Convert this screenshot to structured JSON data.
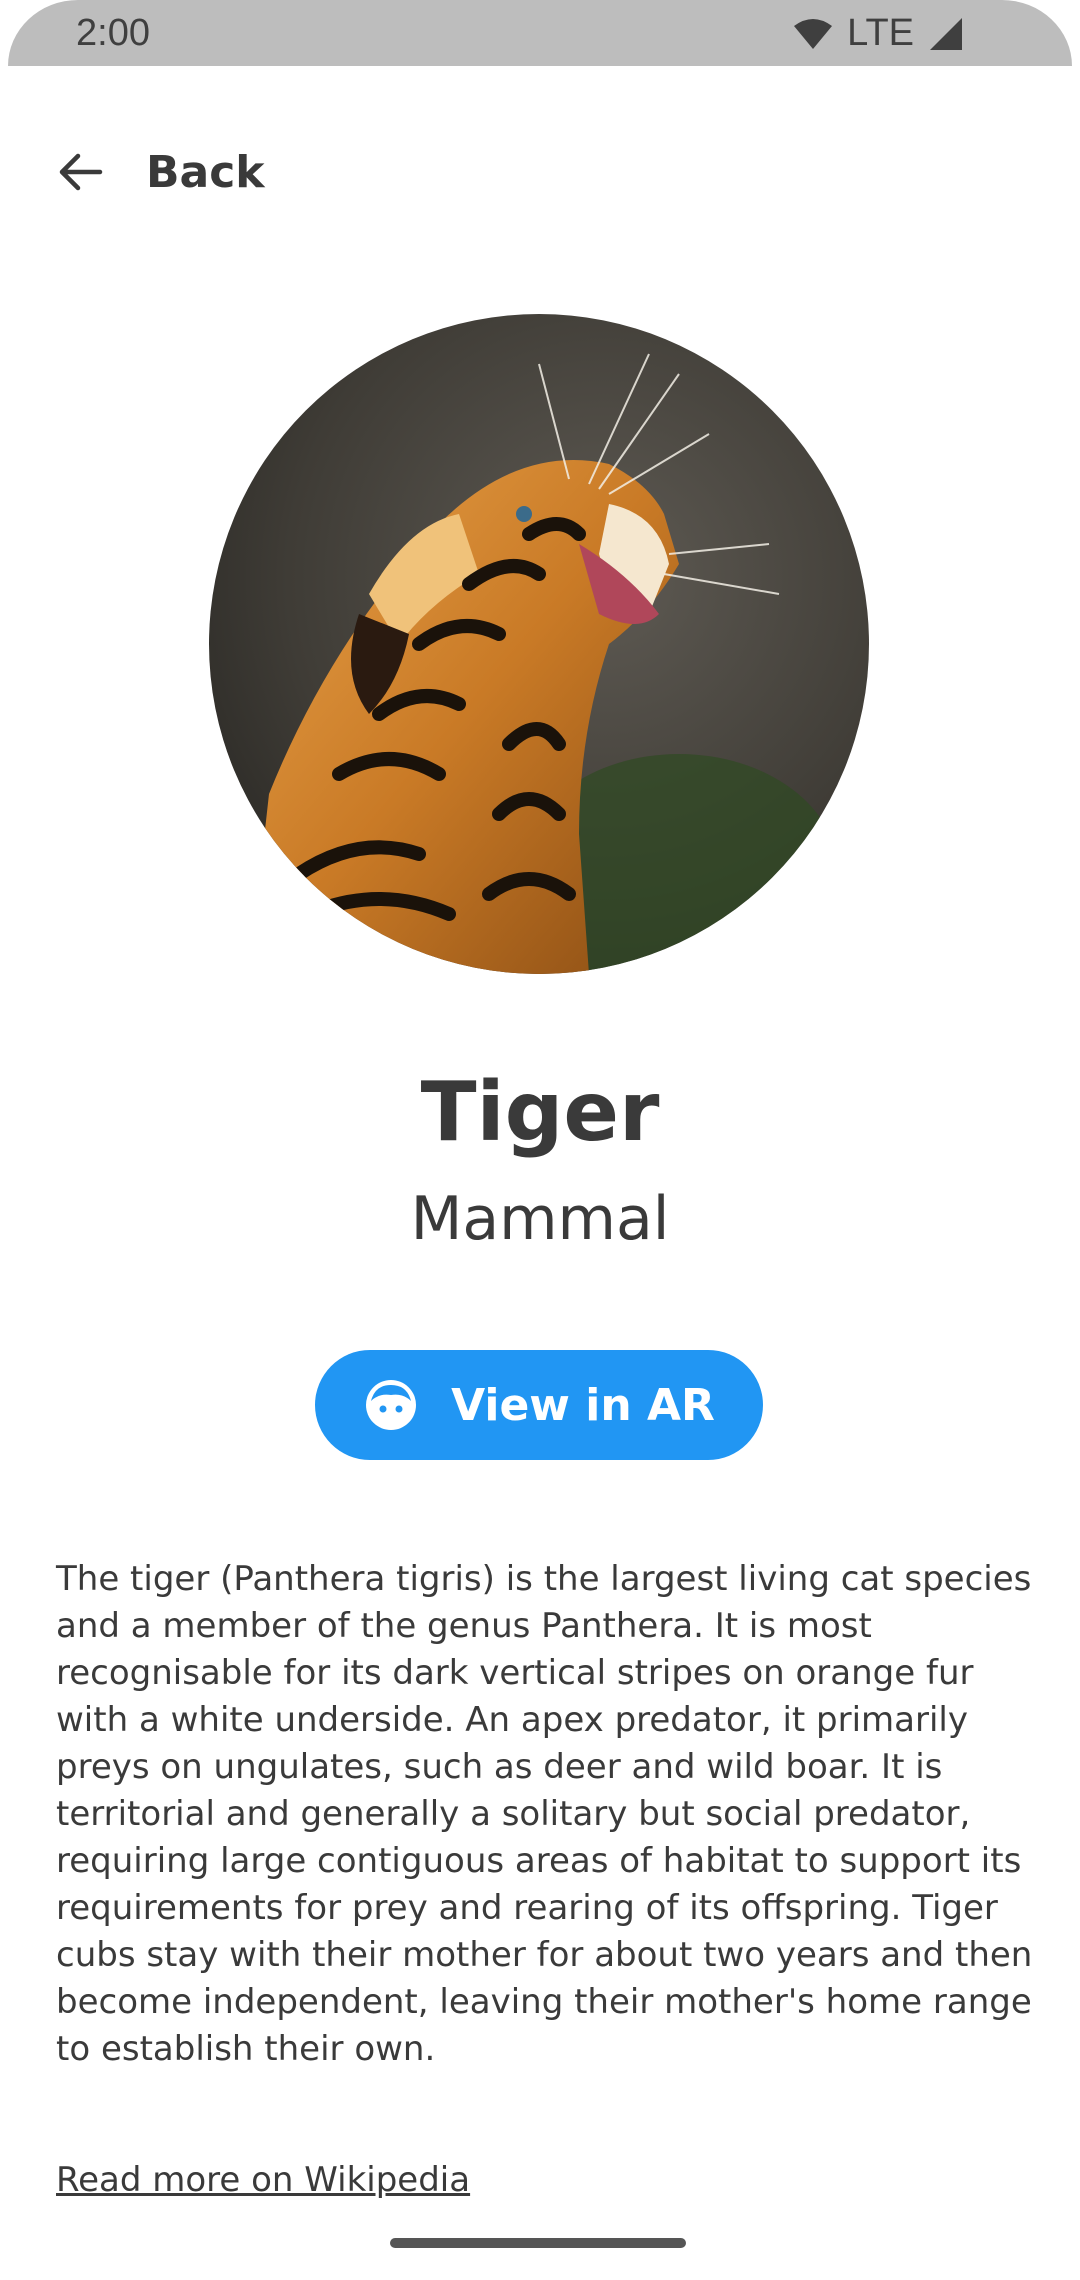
{
  "status_bar": {
    "time": "2:00",
    "network": "LTE"
  },
  "header": {
    "back_label": "Back"
  },
  "animal": {
    "name": "Tiger",
    "category": "Mammal",
    "image_icon": "tiger-photo"
  },
  "actions": {
    "ar_label": "View in AR",
    "ar_icon": "face-icon"
  },
  "description": "The tiger (Panthera tigris) is the largest living cat species and a member of the genus Panthera. It is most recognisable for its dark vertical stripes on orange fur with a white underside. An apex predator, it primarily preys on ungulates, such as deer and wild boar. It is territorial and generally a solitary but social predator, requiring large contiguous areas of habitat to support its requirements for prey and rearing of its offspring. Tiger cubs stay with their mother for about two years and then become independent, leaving their mother's home range to establish their own.",
  "link": {
    "label": "Read more on Wikipedia"
  },
  "colors": {
    "accent": "#2196f3",
    "text": "#3a3a3a",
    "status_bar": "#bdbdbd"
  }
}
